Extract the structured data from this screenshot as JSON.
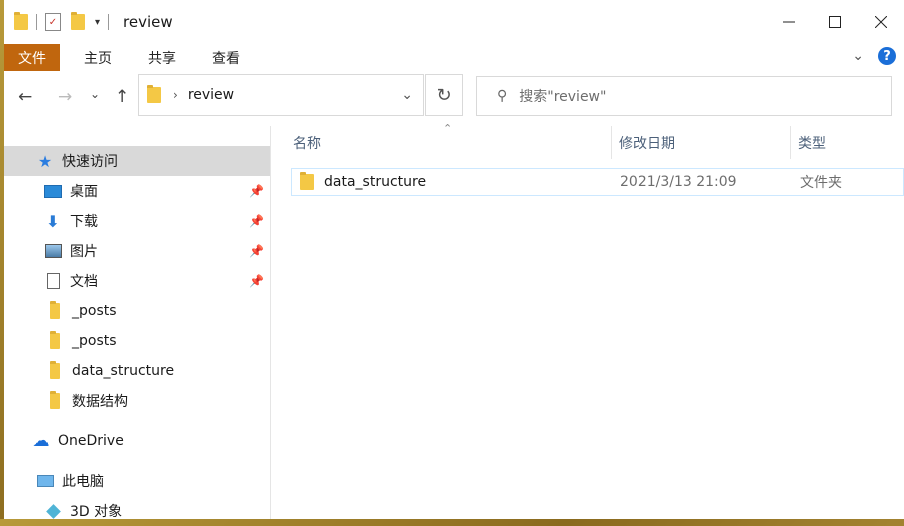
{
  "window": {
    "title": "review"
  },
  "ribbon": {
    "tabs": [
      "文件",
      "主页",
      "共享",
      "查看"
    ]
  },
  "address": {
    "path": "review"
  },
  "search": {
    "placeholder": "搜索\"review\""
  },
  "nav": {
    "quick_access": "快速访问",
    "items": [
      {
        "label": "桌面",
        "icon": "desktop-icon",
        "pinned": true
      },
      {
        "label": "下载",
        "icon": "download-icon",
        "pinned": true
      },
      {
        "label": "图片",
        "icon": "pictures-icon",
        "pinned": true
      },
      {
        "label": "文档",
        "icon": "documents-icon",
        "pinned": true
      },
      {
        "label": "_posts",
        "icon": "folder-icon",
        "pinned": false
      },
      {
        "label": "_posts",
        "icon": "folder-icon",
        "pinned": false
      },
      {
        "label": "data_structure",
        "icon": "folder-icon",
        "pinned": false
      },
      {
        "label": "数据结构",
        "icon": "folder-icon",
        "pinned": false
      }
    ],
    "onedrive": "OneDrive",
    "this_pc": "此电脑",
    "objects_3d": "3D 对象"
  },
  "content": {
    "columns": {
      "name": "名称",
      "modified": "修改日期",
      "type": "类型"
    },
    "files": [
      {
        "name": "data_structure",
        "modified": "2021/3/13 21:09",
        "type": "文件夹"
      }
    ]
  },
  "colors": {
    "file_tab": "#c0660e",
    "selection_border": "#cce8ff",
    "folder": "#f4c845",
    "help": "#1a6ed8"
  }
}
